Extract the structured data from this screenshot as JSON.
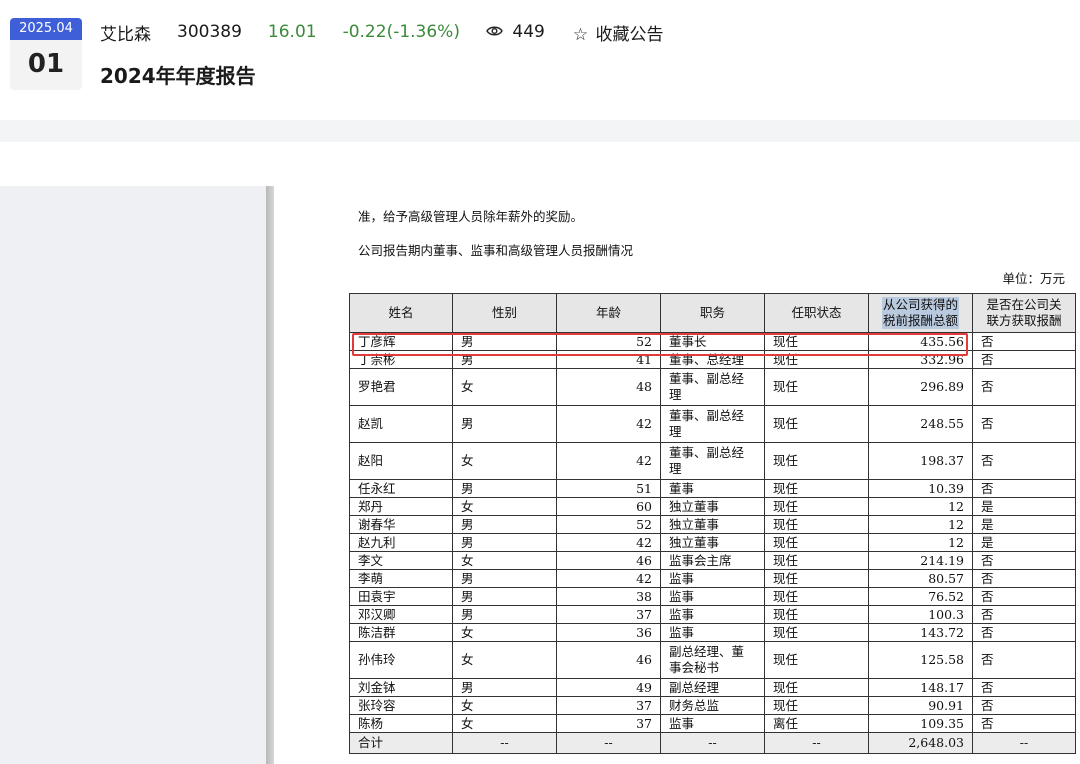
{
  "header": {
    "date_month": "2025.04",
    "date_day": "01",
    "stock_name": "艾比森",
    "stock_code": "300389",
    "price": "16.01",
    "change": "-0.22(-1.36%)",
    "views": "449",
    "favorite_label": "收藏公告",
    "report_title": "2024年年度报告",
    "change_color": "#3a8a3a",
    "badge_color": "#3f5fd8"
  },
  "doc": {
    "paragraph1": "准，给予高级管理人员除年薪外的奖励。",
    "paragraph2": "公司报告期内董事、监事和高级管理人员报酬情况",
    "unit": "单位：万元"
  },
  "table": {
    "headers": {
      "name": "姓名",
      "gender": "性别",
      "age": "年龄",
      "role": "职务",
      "status": "任职状态",
      "pay_line1": "从公司获得的",
      "pay_line2": "税前报酬总额",
      "related_line1": "是否在公司关",
      "related_line2": "联方获取报酬"
    },
    "rows": [
      {
        "name": "丁彦辉",
        "gender": "男",
        "age": "52",
        "role": "董事长",
        "status": "现任",
        "pay": "435.56",
        "related": "否"
      },
      {
        "name": "丁崇彬",
        "gender": "男",
        "age": "41",
        "role": "董事、总经理",
        "status": "现任",
        "pay": "332.96",
        "related": "否"
      },
      {
        "name": "罗艳君",
        "gender": "女",
        "age": "48",
        "role": "董事、副总经理",
        "status": "现任",
        "pay": "296.89",
        "related": "否"
      },
      {
        "name": "赵凯",
        "gender": "男",
        "age": "42",
        "role": "董事、副总经理",
        "status": "现任",
        "pay": "248.55",
        "related": "否"
      },
      {
        "name": "赵阳",
        "gender": "女",
        "age": "42",
        "role": "董事、副总经理",
        "status": "现任",
        "pay": "198.37",
        "related": "否"
      },
      {
        "name": "任永红",
        "gender": "男",
        "age": "51",
        "role": "董事",
        "status": "现任",
        "pay": "10.39",
        "related": "否"
      },
      {
        "name": "郑丹",
        "gender": "女",
        "age": "60",
        "role": "独立董事",
        "status": "现任",
        "pay": "12",
        "related": "是"
      },
      {
        "name": "谢春华",
        "gender": "男",
        "age": "52",
        "role": "独立董事",
        "status": "现任",
        "pay": "12",
        "related": "是"
      },
      {
        "name": "赵九利",
        "gender": "男",
        "age": "42",
        "role": "独立董事",
        "status": "现任",
        "pay": "12",
        "related": "是"
      },
      {
        "name": "李文",
        "gender": "女",
        "age": "46",
        "role": "监事会主席",
        "status": "现任",
        "pay": "214.19",
        "related": "否"
      },
      {
        "name": "李萌",
        "gender": "男",
        "age": "42",
        "role": "监事",
        "status": "现任",
        "pay": "80.57",
        "related": "否"
      },
      {
        "name": "田袁宇",
        "gender": "男",
        "age": "38",
        "role": "监事",
        "status": "现任",
        "pay": "76.52",
        "related": "否"
      },
      {
        "name": "邓汉卿",
        "gender": "男",
        "age": "37",
        "role": "监事",
        "status": "现任",
        "pay": "100.3",
        "related": "否"
      },
      {
        "name": "陈洁群",
        "gender": "女",
        "age": "36",
        "role": "监事",
        "status": "现任",
        "pay": "143.72",
        "related": "否"
      },
      {
        "name": "孙伟玲",
        "gender": "女",
        "age": "46",
        "role": "副总经理、董事会秘书",
        "status": "现任",
        "pay": "125.58",
        "related": "否"
      },
      {
        "name": "刘金钵",
        "gender": "男",
        "age": "49",
        "role": "副总经理",
        "status": "现任",
        "pay": "148.17",
        "related": "否"
      },
      {
        "name": "张玲容",
        "gender": "女",
        "age": "37",
        "role": "财务总监",
        "status": "现任",
        "pay": "90.91",
        "related": "否"
      },
      {
        "name": "陈杨",
        "gender": "女",
        "age": "37",
        "role": "监事",
        "status": "离任",
        "pay": "109.35",
        "related": "否"
      }
    ],
    "total": {
      "label": "合计",
      "dash": "--",
      "pay": "2,648.03"
    }
  }
}
